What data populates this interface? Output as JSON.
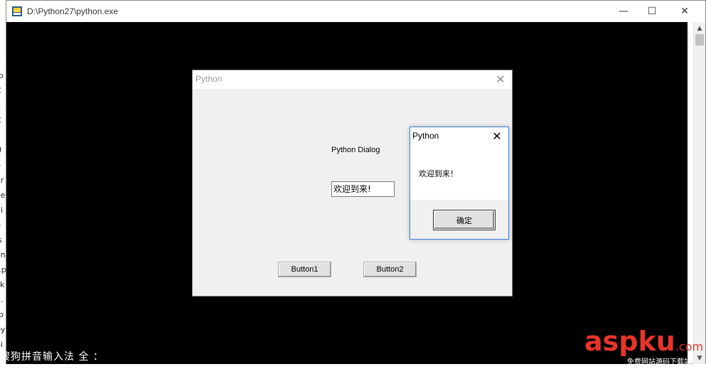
{
  "console": {
    "title": "D:\\Python27\\python.exe",
    "min_label": "—",
    "max_label": "☐",
    "close_label": "✕",
    "scroll_up": "▲",
    "scroll_down": "▼"
  },
  "background_strip": [
    "u",
    "n",
    "-p",
    "C",
    "y",
    "C",
    "g",
    "U",
    "p",
    "ar",
    "ee",
    "ui",
    "p",
    "is",
    "en",
    "t.p",
    "ck",
    "n.",
    "-p",
    "py",
    "pi"
  ],
  "ime": {
    "text": "搜狗拼音输入法 全 ："
  },
  "dialog": {
    "title": "Python",
    "close": "✕",
    "label": "Python Dialog",
    "input_value": "欢迎到来!",
    "button1": "Button1",
    "button2": "Button2"
  },
  "messagebox": {
    "title": "Python",
    "close": "✕",
    "text": "欢迎到来！",
    "ok": "确定",
    "border_color": "#3b7fd0"
  },
  "watermark": {
    "main": "aspku",
    "suffix": ".com",
    "tagline": "免费网站源码下载站!",
    "color": "#e7342a"
  }
}
